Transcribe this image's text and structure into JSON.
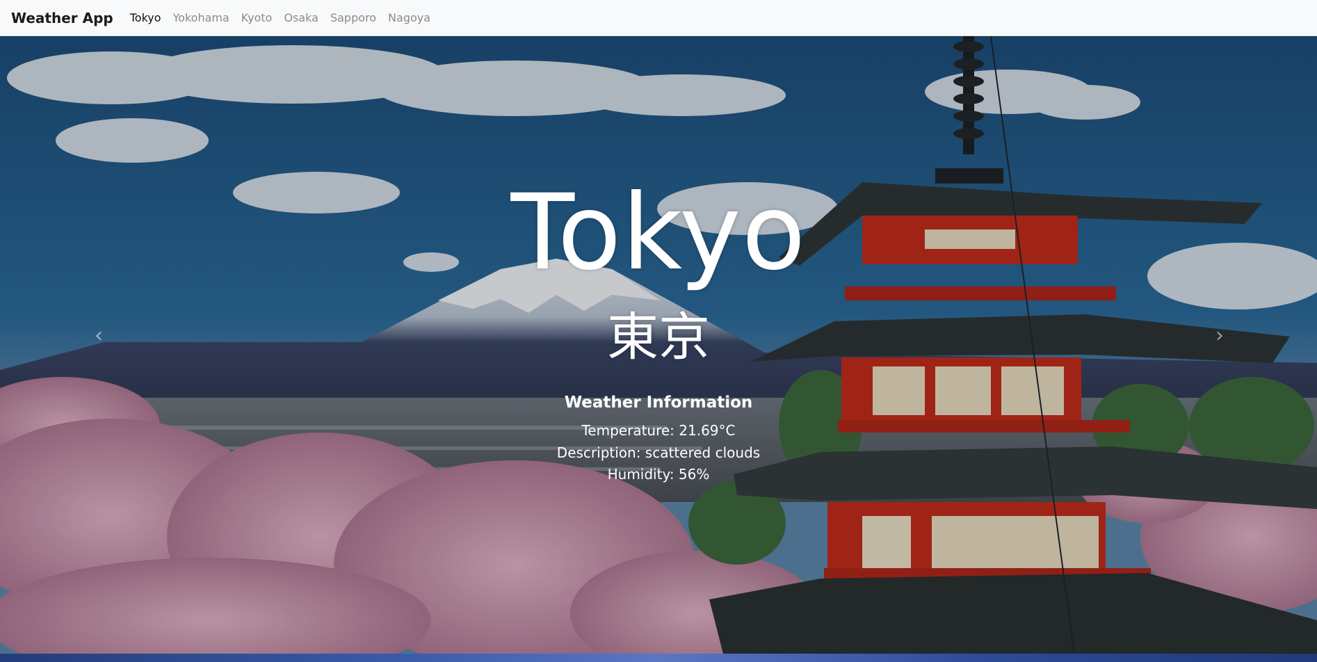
{
  "navbar": {
    "brand": "Weather App",
    "links": [
      {
        "label": "Tokyo",
        "active": true
      },
      {
        "label": "Yokohama",
        "active": false
      },
      {
        "label": "Kyoto",
        "active": false
      },
      {
        "label": "Osaka",
        "active": false
      },
      {
        "label": "Sapporo",
        "active": false
      },
      {
        "label": "Nagoya",
        "active": false
      }
    ]
  },
  "slide": {
    "city": "Tokyo",
    "city_jp": "東京",
    "weather_heading": "Weather Information",
    "temperature": "Temperature: 21.69°C",
    "description": "Description: scattered clouds",
    "humidity": "Humidity: 56%"
  },
  "controls": {
    "prev_icon": "chevron-left-icon",
    "next_icon": "chevron-right-icon"
  }
}
